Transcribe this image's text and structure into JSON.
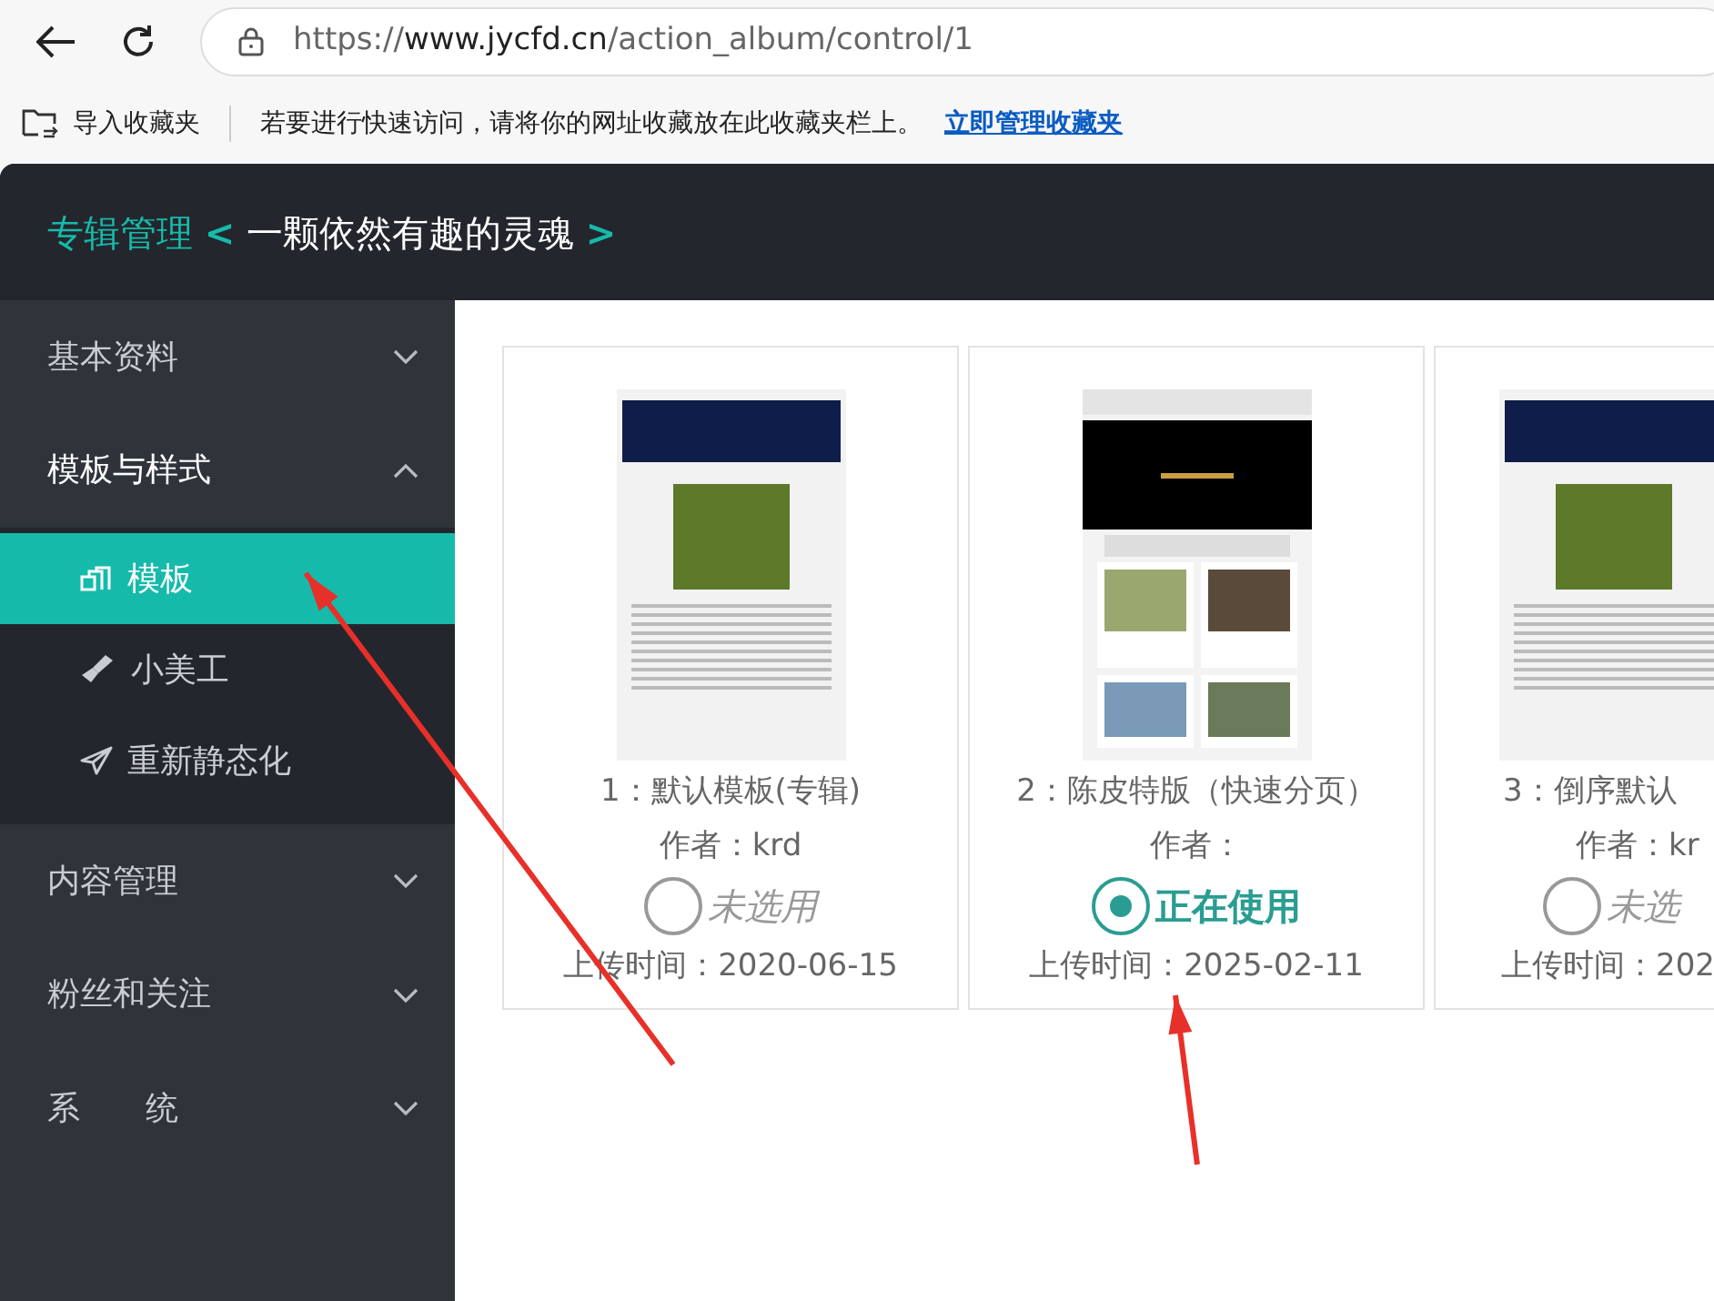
{
  "browser": {
    "url": {
      "scheme": "https://",
      "host": "www.jycfd.cn",
      "path": "/action_album/control/1"
    }
  },
  "bookmarks_bar": {
    "import": "导入收藏夹",
    "message": "若要进行快速访问，请将你的网址收藏放在此收藏夹栏上。",
    "link": "立即管理收藏夹"
  },
  "header": {
    "section": "专辑管理",
    "open": "<",
    "album": "一颗依然有趣的灵魂",
    "close": ">"
  },
  "sidebar": {
    "items": [
      {
        "label": "基本资料",
        "expanded": false
      },
      {
        "label": "模板与样式",
        "expanded": true,
        "children": [
          {
            "label": "模板",
            "selected": true
          },
          {
            "label": "小美工",
            "selected": false
          },
          {
            "label": "重新静态化",
            "selected": false
          }
        ]
      },
      {
        "label": "内容管理",
        "expanded": false
      },
      {
        "label": "粉丝和关注",
        "expanded": false
      },
      {
        "label": "系　　统",
        "expanded": false
      }
    ]
  },
  "templates": [
    {
      "name": "1：默认模板(专辑)",
      "author": "作者：krd",
      "selected": false,
      "status": "未选用",
      "uploaded": "上传时间：2020-06-15",
      "kind": "classic"
    },
    {
      "name": "2：陈皮特版（快速分页）",
      "author": "作者：",
      "selected": true,
      "status": "正在使用",
      "uploaded": "上传时间：2025-02-11",
      "kind": "gallery"
    },
    {
      "name": "3：倒序默认",
      "author": "作者：kr",
      "selected": false,
      "status": "未选",
      "uploaded": "上传时间：202",
      "kind": "classic"
    }
  ]
}
